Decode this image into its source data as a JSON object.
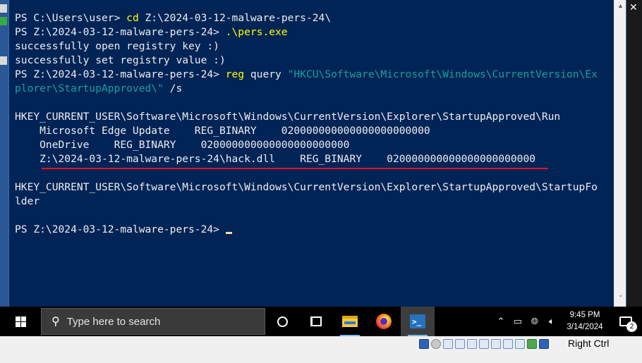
{
  "console": {
    "lines": [
      {
        "segments": [
          {
            "t": "PS C:\\Users\\user> ",
            "c": "arg"
          },
          {
            "t": "cd",
            "c": "cmd"
          },
          {
            "t": " Z:\\2024-03-12-malware-pers-24\\",
            "c": "arg"
          }
        ]
      },
      {
        "segments": [
          {
            "t": "PS Z:\\2024-03-12-malware-pers-24> ",
            "c": "arg"
          },
          {
            "t": ".\\pers.exe",
            "c": "cmd"
          }
        ]
      },
      {
        "segments": [
          {
            "t": "successfully open registry key :)",
            "c": "arg"
          }
        ]
      },
      {
        "segments": [
          {
            "t": "successfully set registry value :)",
            "c": "arg"
          }
        ]
      },
      {
        "segments": [
          {
            "t": "PS Z:\\2024-03-12-malware-pers-24> ",
            "c": "arg"
          },
          {
            "t": "reg",
            "c": "cmd"
          },
          {
            "t": " query ",
            "c": "arg"
          },
          {
            "t": "\"HKCU\\Software\\Microsoft\\Windows\\CurrentVersion\\Ex",
            "c": "str"
          }
        ]
      },
      {
        "segments": [
          {
            "t": "plorer\\StartupApproved\\\"",
            "c": "str"
          },
          {
            "t": " /s",
            "c": "arg"
          }
        ]
      },
      {
        "segments": [
          {
            "t": "",
            "c": "arg"
          }
        ]
      },
      {
        "segments": [
          {
            "t": "HKEY_CURRENT_USER\\Software\\Microsoft\\Windows\\CurrentVersion\\Explorer\\StartupApproved\\Run",
            "c": "arg"
          }
        ]
      },
      {
        "segments": [
          {
            "t": "    Microsoft Edge Update    REG_BINARY    020000000000000000000000",
            "c": "arg"
          }
        ]
      },
      {
        "segments": [
          {
            "t": "    OneDrive    REG_BINARY    020000000000000000000000",
            "c": "arg"
          }
        ]
      },
      {
        "segments": [
          {
            "t": "    Z:\\2024-03-12-malware-pers-24\\hack.dll    REG_BINARY    020000000000000000000000",
            "c": "arg"
          }
        ]
      },
      {
        "segments": [
          {
            "t": "",
            "c": "arg"
          }
        ]
      },
      {
        "segments": [
          {
            "t": "HKEY_CURRENT_USER\\Software\\Microsoft\\Windows\\CurrentVersion\\Explorer\\StartupApproved\\StartupFo",
            "c": "arg"
          }
        ]
      },
      {
        "segments": [
          {
            "t": "lder",
            "c": "arg"
          }
        ]
      },
      {
        "segments": [
          {
            "t": "",
            "c": "arg"
          }
        ]
      },
      {
        "segments": [
          {
            "t": "PS Z:\\2024-03-12-malware-pers-24> ",
            "c": "arg"
          }
        ],
        "cursor": true
      }
    ],
    "highlight_color": "#e81123"
  },
  "taskbar": {
    "search_placeholder": "Type here to search",
    "apps": [
      {
        "name": "file-explorer",
        "open": true
      },
      {
        "name": "firefox",
        "open": false
      },
      {
        "name": "powershell",
        "open": true,
        "active": true
      }
    ],
    "clock_time": "9:45 PM",
    "clock_date": "3/14/2024",
    "notification_count": "2"
  },
  "hostbar": {
    "right_ctrl_label": "Right Ctrl"
  },
  "colors": {
    "console_bg": "#012456",
    "command": "#ffff00",
    "string": "#1a9fa0",
    "text": "#eeedf0"
  }
}
